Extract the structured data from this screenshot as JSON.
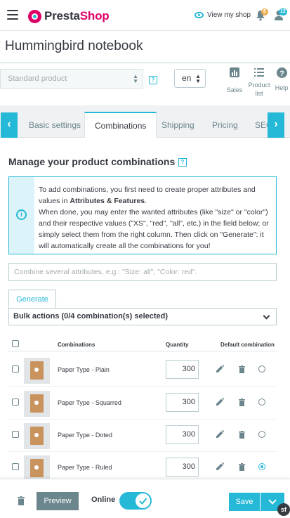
{
  "header": {
    "brand_part1": "Presta",
    "brand_part2": "Shop",
    "view_shop": "View my shop",
    "notifications_count": "6",
    "messages_count": "12"
  },
  "product": {
    "name": "Hummingbird notebook",
    "type": "Standard product",
    "language": "en"
  },
  "toolbar": {
    "sales": "Sales",
    "product_list": "Product list",
    "help": "Help"
  },
  "tabs": [
    {
      "label": "Basic settings"
    },
    {
      "label": "Combinations"
    },
    {
      "label": "Shipping"
    },
    {
      "label": "Pricing"
    },
    {
      "label": "SEO"
    }
  ],
  "combinations": {
    "section_title": "Manage your product combinations",
    "alert_line1": "To add combinations, you first need to create proper attributes and values in ",
    "alert_link": "Attributes & Features",
    "alert_line1_end": ".",
    "alert_line2": "When done, you may enter the wanted attributes (like \"size\" or \"color\") and their respective values (\"XS\", \"red\", \"all\", etc.) in the field below; or simply select them from the right column. Then click on \"Generate\": it will automatically create all the combinations for you!",
    "combine_placeholder": "Combine several attributes, e.g.: \"Size: all\", \"Color: red\".",
    "generate_label": "Generate",
    "bulk_actions": "Bulk actions (0/4 combination(s) selected)",
    "col_combinations": "Combinations",
    "col_quantity": "Quantity",
    "col_default": "Default combination",
    "rows": [
      {
        "name": "Paper Type - Plain",
        "quantity": "300",
        "default": false
      },
      {
        "name": "Paper Type - Squarred",
        "quantity": "300",
        "default": false
      },
      {
        "name": "Paper Type - Doted",
        "quantity": "300",
        "default": false
      },
      {
        "name": "Paper Type - Ruled",
        "quantity": "300",
        "default": true
      }
    ]
  },
  "footer": {
    "preview": "Preview",
    "online": "Online",
    "online_enabled": true,
    "save": "Save"
  },
  "colors": {
    "accent": "#25b9d7",
    "brand_pink": "#df0067",
    "text": "#363a41",
    "secondary_button": "#6c868e"
  }
}
